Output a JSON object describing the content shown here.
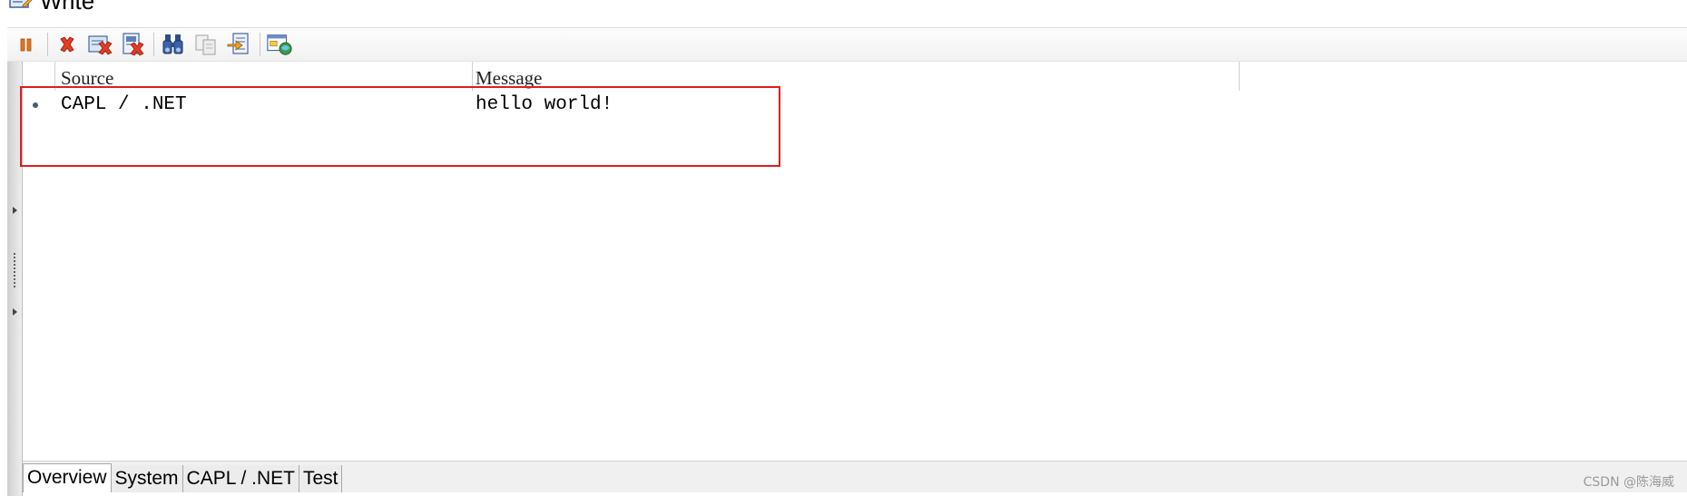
{
  "window": {
    "title": "Write"
  },
  "toolbar": {
    "buttons": [
      {
        "name": "pause-icon"
      },
      {
        "name": "clear-icon"
      },
      {
        "name": "clear-all-icon"
      },
      {
        "name": "delete-page-icon"
      },
      {
        "name": "find-icon"
      },
      {
        "name": "copy-icon"
      },
      {
        "name": "export-icon"
      },
      {
        "name": "options-icon"
      }
    ]
  },
  "grid": {
    "columns": [
      "Source",
      "Message"
    ],
    "rows": [
      {
        "source": "CAPL / .NET",
        "message": "hello world!"
      }
    ]
  },
  "tabs": {
    "items": [
      "Overview",
      "System",
      "CAPL / .NET",
      "Test"
    ],
    "active": "Overview"
  },
  "watermark": "CSDN @陈海威",
  "colors": {
    "highlight": "#e01e1e",
    "toolbar_bg": "#f3f3f3"
  }
}
